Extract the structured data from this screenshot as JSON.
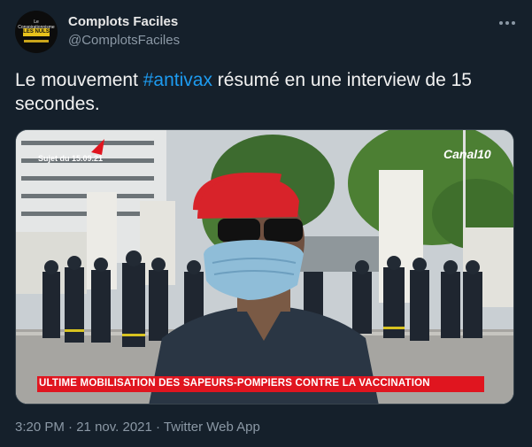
{
  "author": {
    "name": "Complots Faciles",
    "handle": "@ComplotsFaciles",
    "avatar_text_top": "Le Conspirationnisme",
    "avatar_text_main": "LES NULS"
  },
  "menu_icon": "more-horizontal-icon",
  "tweet": {
    "text_before": "Le mouvement ",
    "hashtag": "#antivax",
    "text_after": " résumé en une interview de 15 secondes."
  },
  "media": {
    "date_overlay": "Sujet du 15.09.21",
    "channel_logo": "Canal10",
    "banner_text": "ULTIME MOBILISATION DES SAPEURS-POMPIERS CONTRE LA VACCINATION"
  },
  "footer": {
    "time": "3:20 PM",
    "separator": " · ",
    "date": "21 nov. 2021",
    "source": "Twitter Web App"
  }
}
